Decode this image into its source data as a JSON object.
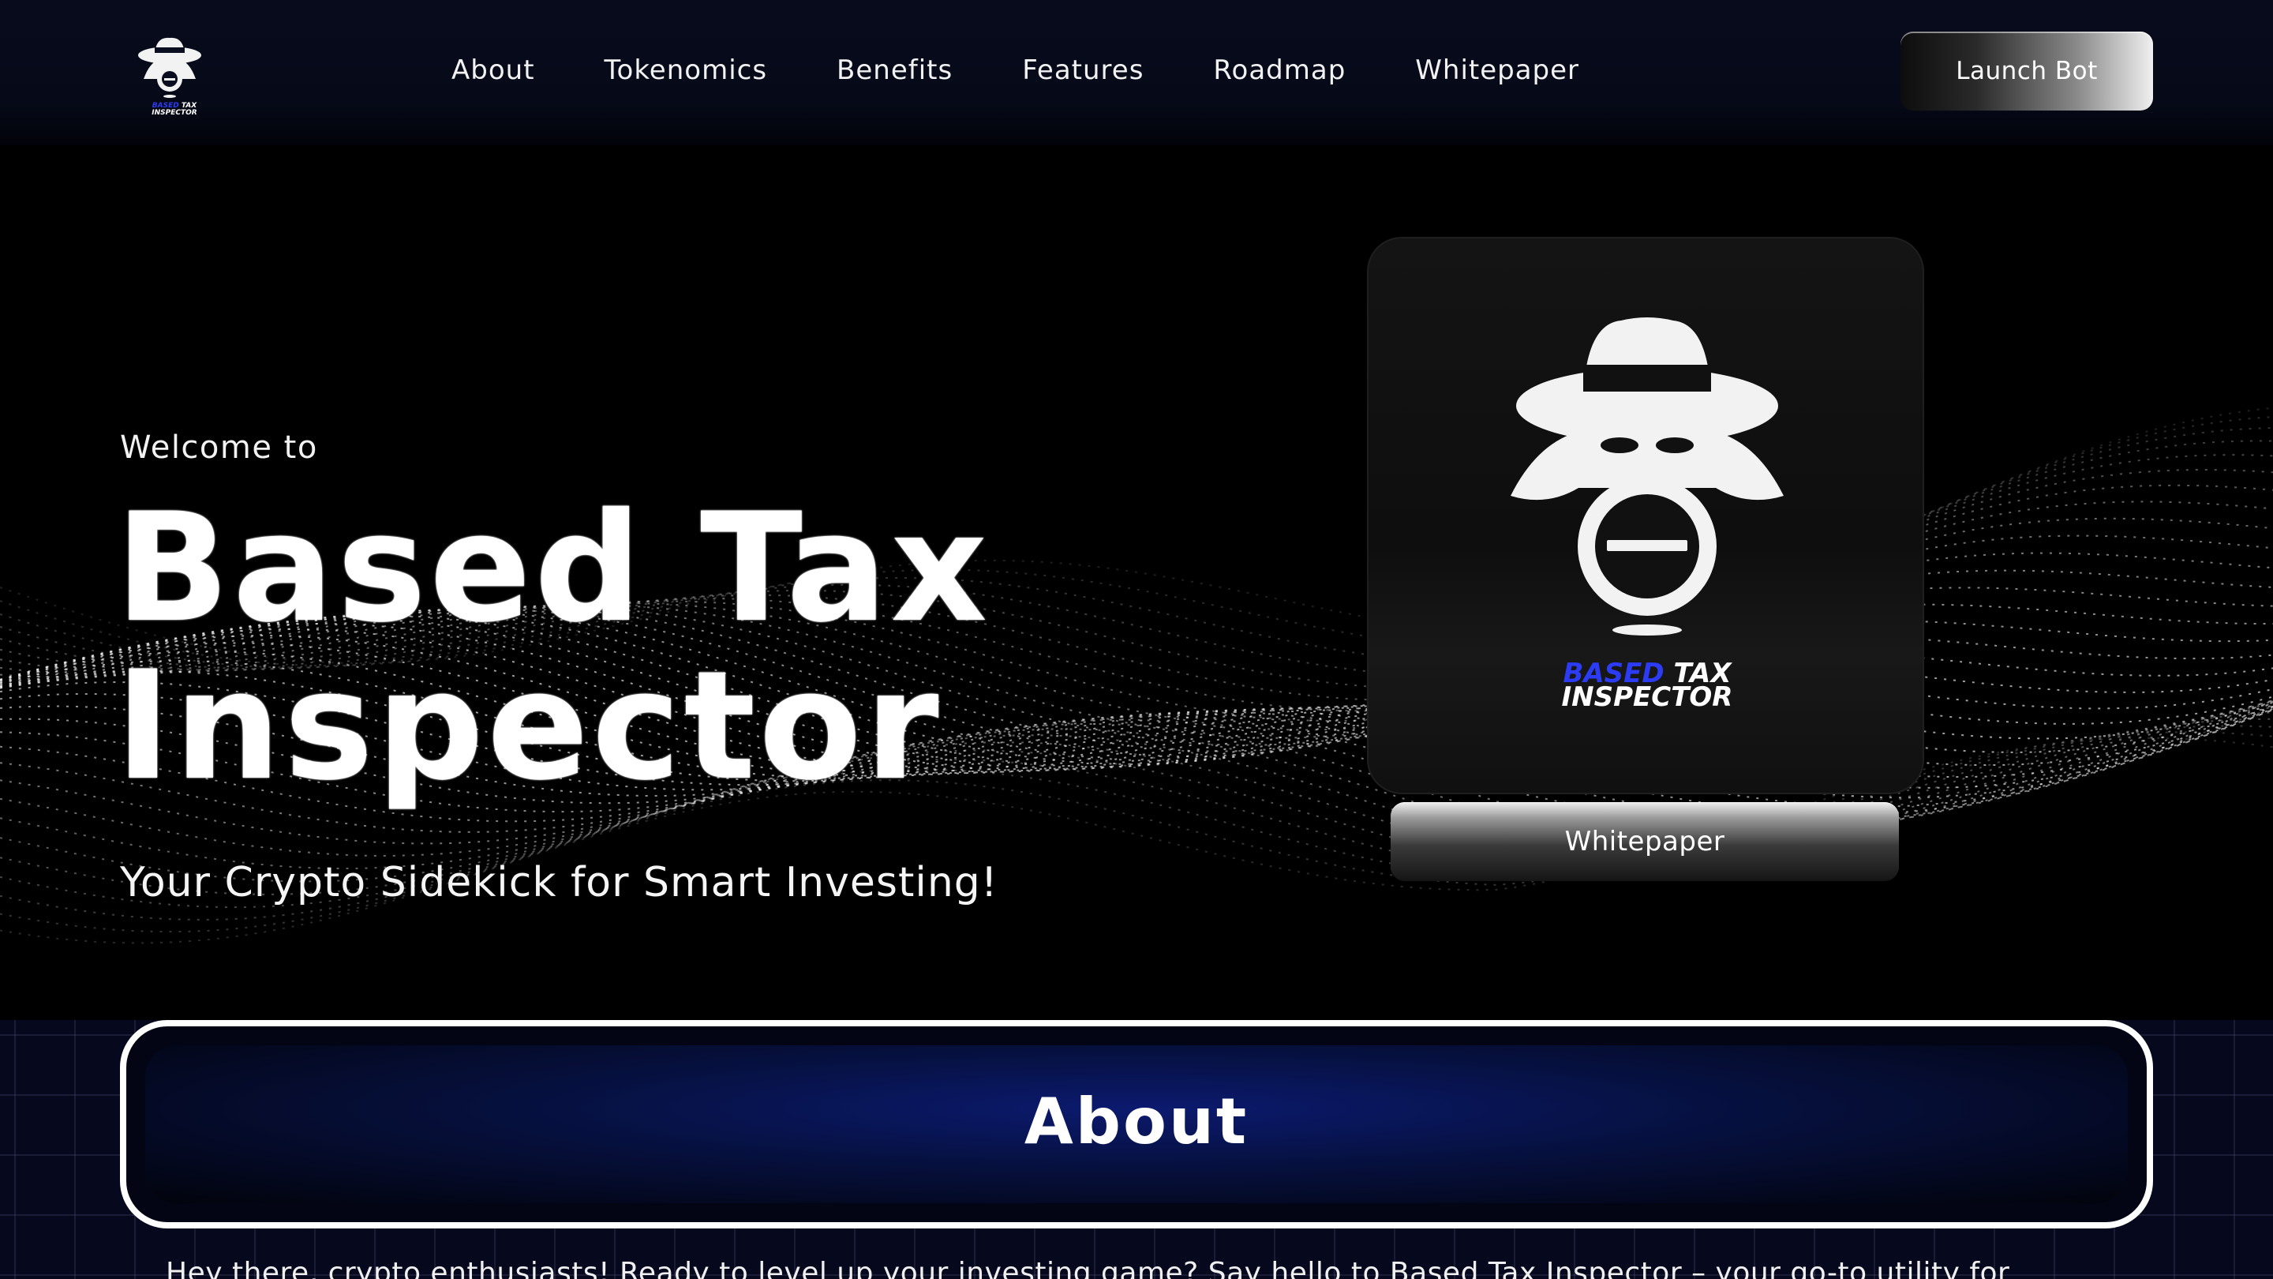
{
  "nav": {
    "logo_icon": "spy-detective-icon",
    "logo_text_line1_a": "BASED",
    "logo_text_line1_b": "TAX",
    "logo_text_line2": "INSPECTOR",
    "links": [
      {
        "label": "About"
      },
      {
        "label": "Tokenomics"
      },
      {
        "label": "Benefits"
      },
      {
        "label": "Features"
      },
      {
        "label": "Roadmap"
      },
      {
        "label": "Whitepaper"
      }
    ],
    "launch_label": "Launch Bot"
  },
  "hero": {
    "welcome": "Welcome to",
    "title_line1": "Based Tax",
    "title_line2": "Inspector",
    "tagline": "Your Crypto Sidekick for Smart Investing!",
    "card_brand_a": "BASED",
    "card_brand_b": "TAX",
    "card_brand_c": "INSPECTOR",
    "whitepaper_label": "Whitepaper"
  },
  "about": {
    "title": "About",
    "text": "Hey there, crypto enthusiasts! Ready to level up your investing game? Say hello to Based Tax Inspector – your go-to utility for"
  },
  "colors": {
    "brand_blue": "#2c3cf5",
    "nav_bg": "#070b1c",
    "grid_bg": "#06081d"
  }
}
